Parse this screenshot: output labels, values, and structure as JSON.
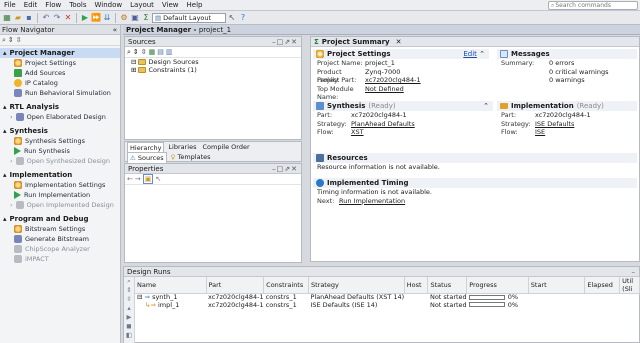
{
  "menubar": {
    "items": [
      "File",
      "Edit",
      "Flow",
      "Tools",
      "Window",
      "Layout",
      "View",
      "Help"
    ],
    "search_placeholder": "Search commands"
  },
  "toolbar": {
    "layout": "Default Layout"
  },
  "flow_navigator": {
    "title": "Flow Navigator",
    "sections": [
      {
        "label": "Project Manager",
        "items": [
          "Project Settings",
          "Add Sources",
          "IP Catalog",
          "Run Behavioral Simulation"
        ]
      },
      {
        "label": "RTL Analysis",
        "items": [
          "Open Elaborated Design"
        ]
      },
      {
        "label": "Synthesis",
        "items": [
          "Synthesis Settings",
          "Run Synthesis",
          "Open Synthesized Design"
        ]
      },
      {
        "label": "Implementation",
        "items": [
          "Implementation Settings",
          "Run Implementation",
          "Open Implemented Design"
        ]
      },
      {
        "label": "Program and Debug",
        "items": [
          "Bitstream Settings",
          "Generate Bitstream",
          "ChipScope Analyzer",
          "iMPACT"
        ]
      }
    ]
  },
  "project_manager": {
    "title": "Project Manager",
    "project": "project_1"
  },
  "sources": {
    "title": "Sources",
    "tree": [
      "Design Sources",
      "Constraints (1)"
    ],
    "tabs": [
      "Hierarchy",
      "Libraries",
      "Compile Order"
    ],
    "subtabs": [
      "Sources",
      "Templates"
    ]
  },
  "properties": {
    "title": "Properties"
  },
  "summary": {
    "tab": "Project Summary",
    "project_settings": {
      "title": "Project Settings",
      "edit": "Edit",
      "rows": [
        [
          "Project Name:",
          "project_1"
        ],
        [
          "Product Family:",
          "Zynq-7000"
        ],
        [
          "Project Part:",
          "xc7z020clg484-1"
        ],
        [
          "Top Module Name:",
          "Not Defined"
        ]
      ]
    },
    "messages": {
      "title": "Messages",
      "rows": [
        [
          "Summary:",
          "0 errors"
        ],
        [
          "",
          "0 critical warnings"
        ],
        [
          "",
          "0 warnings"
        ]
      ]
    },
    "synthesis": {
      "title": "Synthesis",
      "status": "(Ready)",
      "rows": [
        [
          "Part:",
          "xc7z020clg484-1"
        ],
        [
          "Strategy:",
          "PlanAhead Defaults"
        ],
        [
          "Flow:",
          "XST"
        ]
      ]
    },
    "implementation": {
      "title": "Implementation",
      "status": "(Ready)",
      "rows": [
        [
          "Part:",
          "xc7z020clg484-1"
        ],
        [
          "Strategy:",
          "ISE Defaults"
        ],
        [
          "Flow:",
          "ISE"
        ]
      ]
    },
    "resources": {
      "title": "Resources",
      "text": "Resource information is not available."
    },
    "timing": {
      "title": "Implemented Timing",
      "text": "Timing information is not available.",
      "next_label": "Next:",
      "next_link": "Run Implementation"
    }
  },
  "design_runs": {
    "title": "Design Runs",
    "columns": [
      "Name",
      "Part",
      "Constraints",
      "Strategy",
      "Host",
      "Status",
      "Progress",
      "Start",
      "Elapsed",
      "Util (Sli"
    ],
    "rows": [
      {
        "name": "synth_1",
        "part": "xc7z020clg484-1",
        "constraints": "constrs_1",
        "strategy": "PlanAhead Defaults (XST 14)",
        "host": "",
        "status": "Not started",
        "progress": 0,
        "progress_label": "0%"
      },
      {
        "name": "impl_1",
        "part": "xc7z020clg484-1",
        "constraints": "constrs_1",
        "strategy": "ISE Defaults (ISE 14)",
        "host": "",
        "status": "Not started",
        "progress": 0,
        "progress_label": "0%"
      }
    ]
  }
}
